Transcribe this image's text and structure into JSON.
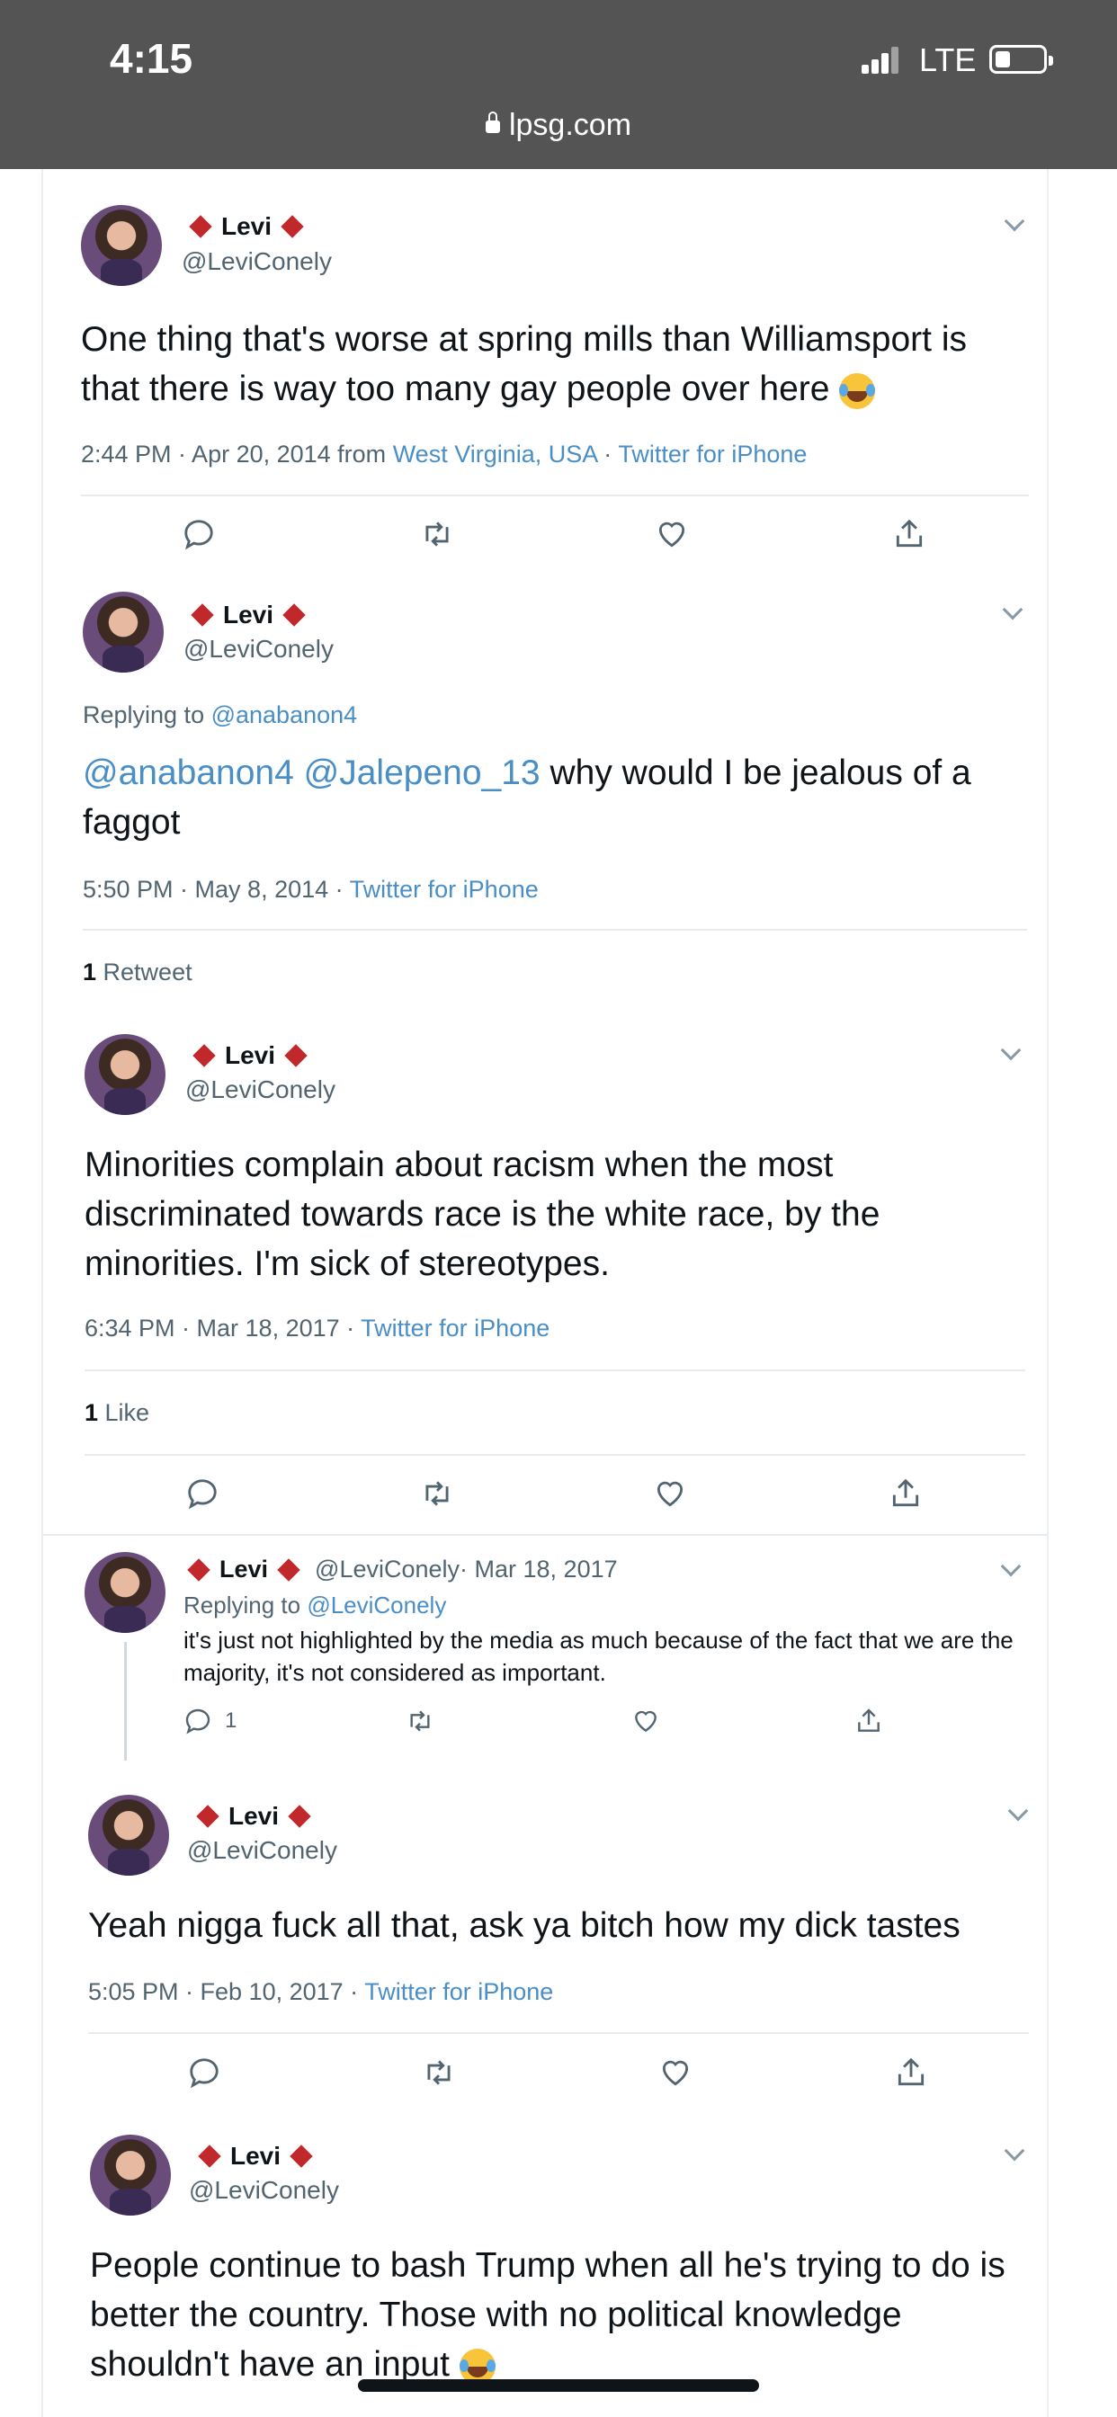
{
  "status_bar": {
    "time": "4:15",
    "network": "LTE"
  },
  "browser": {
    "url": "lpsg.com"
  },
  "tweets": [
    {
      "name": "Levi",
      "handle": "@LeviConely",
      "text": "One thing that's worse at spring mills than Williamsport is that there is way too many gay people over here",
      "emoji": "joy-emoji",
      "time": "2:44 PM · Apr 20, 2014 from ",
      "location": "West Virginia, USA",
      "sep": " · ",
      "source": "Twitter for iPhone"
    },
    {
      "name": "Levi",
      "handle": "@LeviConely",
      "replying_label": "Replying to ",
      "replying_to": "@anabanon4",
      "mention1": "@anabanon4",
      "mention2": "@Jalepeno_13",
      "text": " why would I be jealous of a faggot",
      "time": "5:50 PM · May 8, 2014 · ",
      "source": "Twitter for iPhone",
      "stat_count": "1",
      "stat_label": " Retweet"
    },
    {
      "name": "Levi",
      "handle": "@LeviConely",
      "text": "Minorities complain about racism when the most discriminated towards race is the white race, by the minorities. I'm sick of stereotypes.",
      "time": "6:34 PM · Mar 18, 2017 · ",
      "source": "Twitter for iPhone",
      "stat_count": "1",
      "stat_label": " Like"
    },
    {
      "name": "Levi",
      "handle": "@LeviConely",
      "date": " · Mar 18, 2017",
      "replying_label": "Replying to ",
      "replying_to": "@LeviConely",
      "text": "it's just not highlighted by the media as much because of the fact that we are the majority, it's not considered as important.",
      "reply_count": "1"
    },
    {
      "name": "Levi",
      "handle": "@LeviConely",
      "text": "Yeah nigga fuck all that, ask ya bitch how my dick tastes",
      "time": "5:05 PM · Feb 10, 2017 · ",
      "source": "Twitter for iPhone"
    },
    {
      "name": "Levi",
      "handle": "@LeviConely",
      "text": "People continue to bash Trump when all he's trying to do is better the country. Those with no political knowledge shouldn't have an input",
      "emoji": "joy-emoji"
    }
  ],
  "colors": {
    "link": "#4a8ec6",
    "diamond": "#c0282c",
    "browser_bar": "#545454"
  }
}
